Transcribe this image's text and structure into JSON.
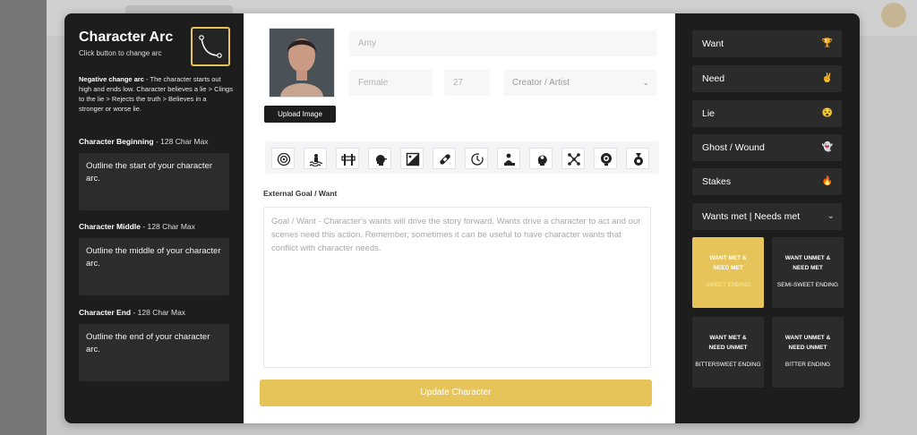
{
  "left_panel": {
    "title": "Character Arc",
    "subtitle": "Click button to change arc",
    "arc_type": "Negative change arc",
    "arc_description": " - The character starts out high and ends low. Character believes a lie > Clings to the lie > Rejects the truth > Believes in a stronger or worse lie.",
    "sections": [
      {
        "label": "Character Beginning",
        "limit": " - 128 Char Max",
        "text": "Outline the start of your character arc."
      },
      {
        "label": "Character Middle",
        "limit": " - 128 Char Max",
        "text": "Outline the middle of your character arc."
      },
      {
        "label": "Character End",
        "limit": " - 128 Char Max",
        "text": "Outline the end of your character arc."
      }
    ]
  },
  "center_panel": {
    "upload_label": "Upload Image",
    "name_placeholder": "Amy",
    "gender_placeholder": "Female",
    "age_placeholder": "27",
    "role_selected": "Creator / Artist",
    "icons": [
      "target-icon",
      "drowning-icon",
      "barrier-icon",
      "speaking-head-icon",
      "image-frame-icon",
      "bandage-icon",
      "history-clock-icon",
      "character-stack-icon",
      "mind-head-icon",
      "network-icon",
      "eye-ring-icon",
      "medal-icon"
    ],
    "goal_label": "External Goal / Want",
    "goal_placeholder": "Goal / Want - Character's wants will drive the story forward. Wants drive a character to act and our scenes need this action. Remember, sometimes it can be useful to have character wants that conflict with character needs.",
    "update_label": "Update Character"
  },
  "right_panel": {
    "buttons": [
      {
        "label": "Want",
        "emoji": "🏆"
      },
      {
        "label": "Need",
        "emoji": "✌️"
      },
      {
        "label": "Lie",
        "emoji": "😵"
      },
      {
        "label": "Ghost / Wound",
        "emoji": "👻"
      },
      {
        "label": "Stakes",
        "emoji": "🔥"
      }
    ],
    "dropdown_label": "Wants met | Needs met",
    "cards": [
      {
        "title_line1": "WANT MET &",
        "title_line2": "NEED MET",
        "ending": "SWEET ENDING"
      },
      {
        "title_line1": "WANT UNMET &",
        "title_line2": "NEED MET",
        "ending": "SEMI-SWEET ENDING"
      },
      {
        "title_line1": "WANT MET &",
        "title_line2": "NEED UNMET",
        "ending": "BITTERSWEET ENDING"
      },
      {
        "title_line1": "WANT UNMET &",
        "title_line2": "NEED UNMET",
        "ending": "BITTER ENDING"
      }
    ]
  },
  "colors": {
    "accent": "#e6c45a",
    "panel": "#1d1d1d",
    "card": "#2b2b2b"
  }
}
